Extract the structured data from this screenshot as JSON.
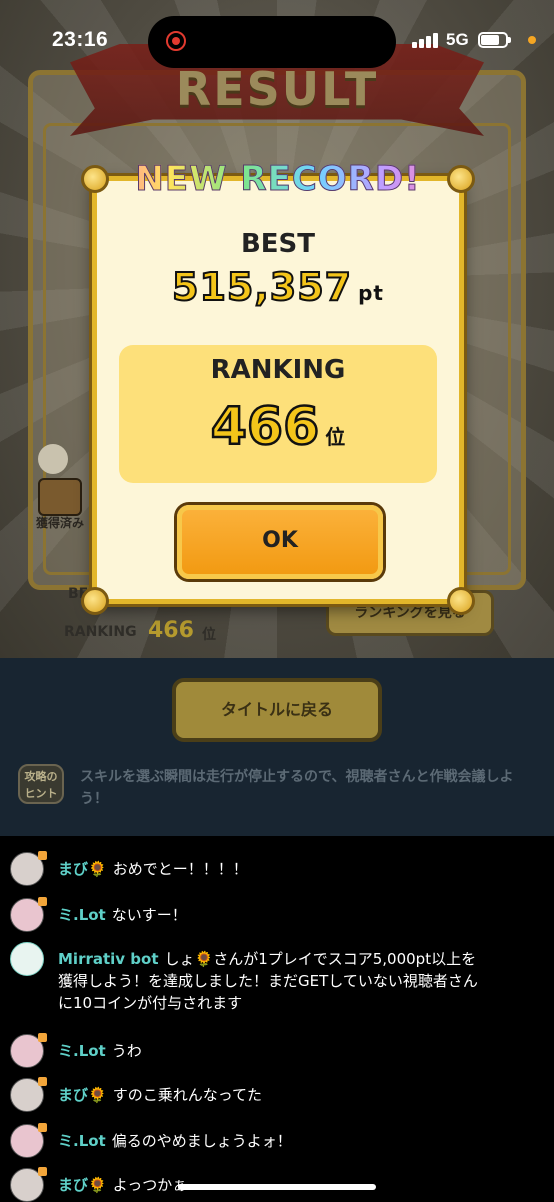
{
  "status_bar": {
    "time": "23:16",
    "network": "5G",
    "icons": [
      "screen-record-icon",
      "signal-icon",
      "battery-icon"
    ]
  },
  "game": {
    "result_title": "RESULT",
    "background_best": "BEST",
    "background_ranking_label": "RANKING",
    "background_ranking_value": "466",
    "background_ranking_unit": "位",
    "acquired_label": "獲得済み",
    "ranking_view_button": "ランキングを見る"
  },
  "modal": {
    "header": "NEW RECORD!",
    "best_label": "BEST",
    "best_score": "515,357",
    "best_unit": "pt",
    "ranking_label": "RANKING",
    "ranking_value": "466",
    "ranking_unit": "位",
    "ok_label": "OK"
  },
  "below_game": {
    "title_back_button": "タイトルに戻る",
    "hint_badge": "攻略の ヒント",
    "hint_text": "スキルを選ぶ瞬間は走行が停止するので、視聴者さんと作戦会議しよう！"
  },
  "chat": {
    "messages": [
      {
        "user": "まび🌻",
        "text": "おめでとー！！！！"
      },
      {
        "user": "ミ.Lot",
        "text": "ないすー！"
      },
      {
        "user": "Mirrativ bot",
        "text": "しょ🌻さんが1プレイでスコア5,000pt以上を獲得しよう！を達成しました！まだGETしていない視聴者さんに10コインが付与されます"
      },
      {
        "user": "ミ.Lot",
        "text": "うわ"
      },
      {
        "user": "まび🌻",
        "text": "すのこ乗れんなってた"
      },
      {
        "user": "ミ.Lot",
        "text": "偏るのやめましょうよォ！"
      },
      {
        "user": "まび🌻",
        "text": "よっつかぁ"
      }
    ]
  },
  "colors": {
    "accent_gold": "#f4c51a",
    "ok_orange": "#f29a12",
    "chat_username": "#5fd0c8",
    "dark_band": "#182531"
  }
}
